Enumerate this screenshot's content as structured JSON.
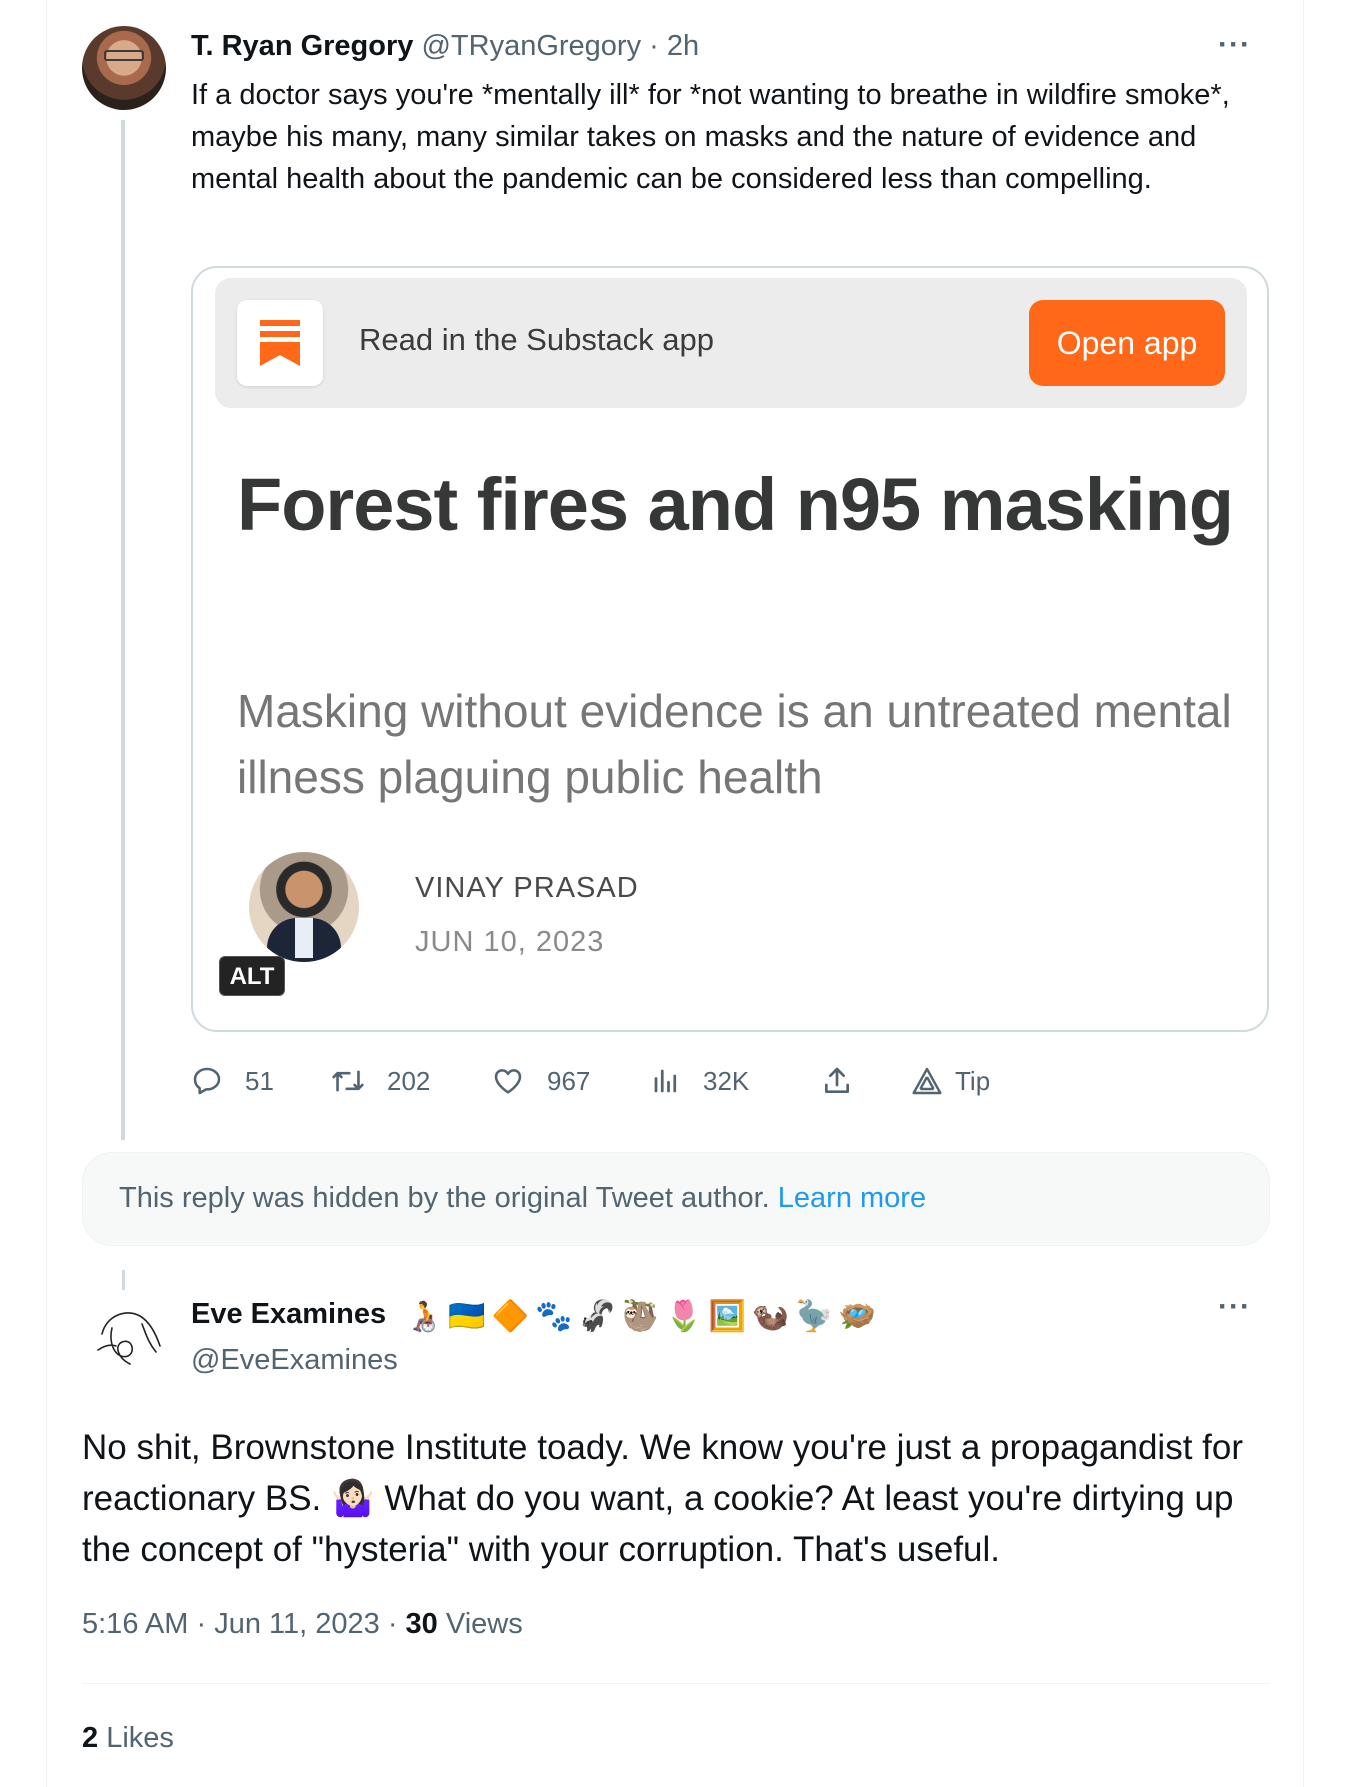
{
  "tweet1": {
    "author_name": "T. Ryan Gregory",
    "author_handle": "@TRyanGregory",
    "time_ago": "2h",
    "meta_separator": "·",
    "more_label": "···",
    "text": "If a doctor says you're *mentally ill* for *not wanting to breathe in wildfire smoke*, maybe his many, many similar takes on masks and the nature of evidence and mental health about the pandemic can be considered less than compelling.",
    "card": {
      "banner_text": "Read in the Substack app",
      "open_app_label": "Open app",
      "title": "Forest fires and n95 masking",
      "subtitle": "Masking without evidence is an untreated mental illness plaguing public health",
      "author": "VINAY PRASAD",
      "date": "JUN 10, 2023",
      "alt_label": "ALT",
      "brand_color": "#ff6719"
    },
    "actions": {
      "replies": "51",
      "retweets": "202",
      "likes": "967",
      "views": "32K",
      "tip_label": "Tip"
    }
  },
  "hidden_reply": {
    "text": "This reply was hidden by the original Tweet author.",
    "link": "Learn more"
  },
  "tweet2": {
    "author_name": "Eve Examines",
    "author_handle": "@EveExamines",
    "name_emojis": [
      "🧑‍🦽",
      "🇺🇦",
      "🔶",
      "🐾",
      "🦨",
      "🦥",
      "🌷",
      "🖼️",
      "🦦",
      "🦤",
      "🪺"
    ],
    "more_label": "···",
    "text_part1": "No shit, Brownstone Institute toady. We know you're just a propagandist for reactionary BS.",
    "emoji_inline": "🤷🏻‍♀️",
    "text_part2": "What do you want, a cookie? At least you're dirtying up the concept of \"hysteria\" with your corruption. That's useful.",
    "time": "5:16 AM",
    "date": "Jun 11, 2023",
    "views_count": "30",
    "views_label": "Views",
    "likes_count": "2",
    "likes_label": "Likes"
  }
}
